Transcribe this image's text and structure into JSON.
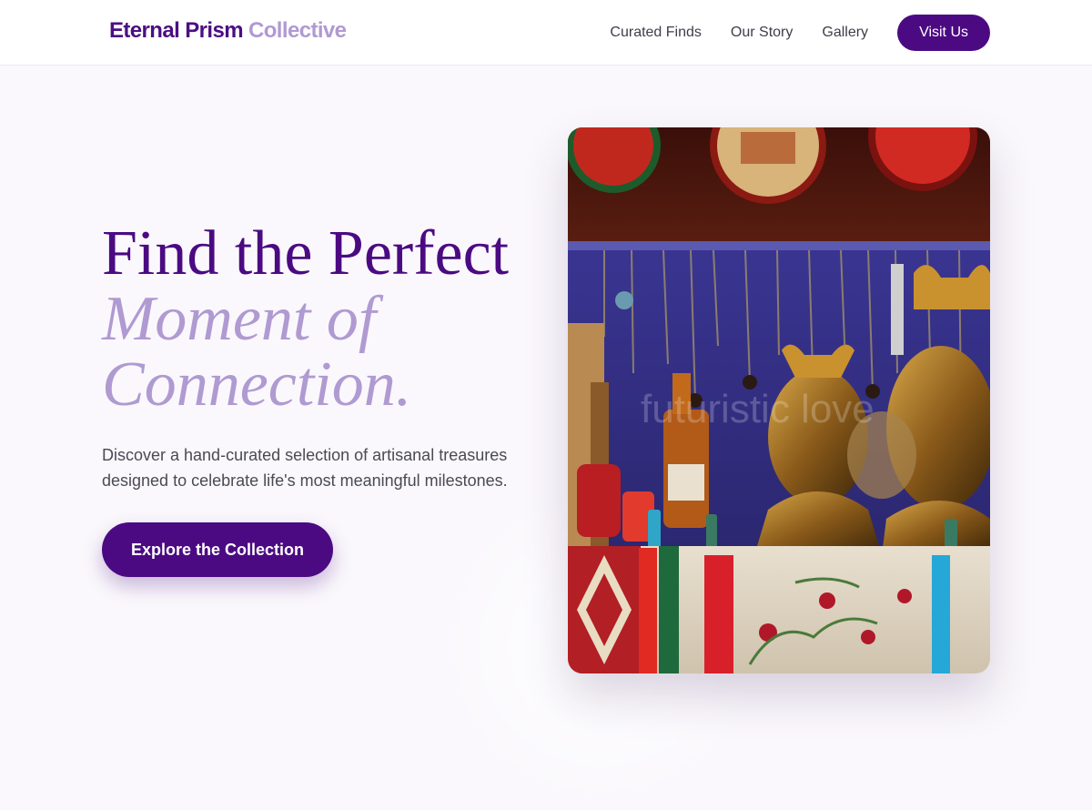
{
  "header": {
    "brand_primary": "Eternal Prism",
    "brand_secondary": "Collective",
    "nav": [
      {
        "label": "Curated Finds"
      },
      {
        "label": "Our Story"
      },
      {
        "label": "Gallery"
      }
    ],
    "cta_label": "Visit Us"
  },
  "hero": {
    "title_line1": "Find the Perfect",
    "title_line2": "Moment of",
    "title_line3": "Connection.",
    "description": "Discover a hand-curated selection of artisanal treasures designed to celebrate life's most meaningful milestones.",
    "cta_label": "Explore the Collection"
  },
  "image": {
    "watermark": "futuristic love"
  },
  "colors": {
    "brand": "#4b0a82",
    "accent": "#b09ad2",
    "background": "#faf8fc"
  }
}
